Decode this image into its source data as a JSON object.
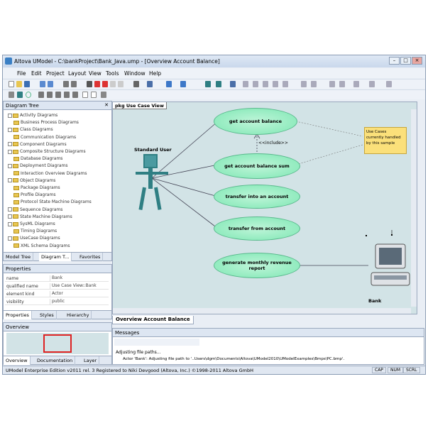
{
  "window": {
    "title": "Altova UModel - C:\\bankProject\\Bank_Java.ump - [Overview Account Balance]"
  },
  "menu": [
    "File",
    "Edit",
    "Project",
    "Layout",
    "View",
    "Tools",
    "Window",
    "Help"
  ],
  "diagram_tree": {
    "title": "Diagram Tree",
    "items": [
      {
        "label": "Activity Diagrams",
        "expand": true
      },
      {
        "label": "Business Process Diagrams",
        "expand": false
      },
      {
        "label": "Class Diagrams",
        "expand": true
      },
      {
        "label": "Communication Diagrams",
        "expand": false
      },
      {
        "label": "Component Diagrams",
        "expand": true
      },
      {
        "label": "Composite Structure Diagrams",
        "expand": true
      },
      {
        "label": "Database Diagrams",
        "expand": false
      },
      {
        "label": "Deployment Diagrams",
        "expand": true
      },
      {
        "label": "Interaction Overview Diagrams",
        "expand": false
      },
      {
        "label": "Object Diagrams",
        "expand": true
      },
      {
        "label": "Package Diagrams",
        "expand": false
      },
      {
        "label": "Profile Diagrams",
        "expand": false
      },
      {
        "label": "Protocol State Machine Diagrams",
        "expand": false
      },
      {
        "label": "Sequence Diagrams",
        "expand": true
      },
      {
        "label": "State Machine Diagrams",
        "expand": true
      },
      {
        "label": "SysML Diagrams",
        "expand": true
      },
      {
        "label": "Timing Diagrams",
        "expand": false
      },
      {
        "label": "UseCase Diagrams",
        "expand": true
      },
      {
        "label": "XML Schema Diagrams",
        "expand": false
      }
    ],
    "tabs": [
      "Model Tree",
      "Diagram T...",
      "Favorites"
    ]
  },
  "properties": {
    "title": "Properties",
    "rows": [
      {
        "key": "name",
        "value": "Bank"
      },
      {
        "key": "qualified name",
        "value": "Use Case View::Bank"
      },
      {
        "key": "element kind",
        "value": "Actor"
      },
      {
        "key": "visibility",
        "value": "public"
      }
    ],
    "tabs": [
      "Properties",
      "Styles",
      "Hierarchy"
    ]
  },
  "overview": {
    "title": "Overview",
    "tabs": [
      "Overview",
      "Documentation",
      "Layer"
    ]
  },
  "diagram": {
    "package_label": "pkg Use Case View",
    "tab_label": "Overview Account Balance",
    "actor_user": "Standard User",
    "actor_bank": "Bank",
    "use_cases": [
      "get account balance",
      "get account balance sum",
      "transfer into an account",
      "transfer from account",
      "generate monthly revenue report"
    ],
    "include_label": "<<include>>",
    "note": "Use Cases currently handled by this sample"
  },
  "messages": {
    "title": "Messages",
    "lines": [
      "Adjusting file paths...",
      "Actor 'Bank': Adjusting file path to '..Users\\dgm\\Documents\\Altova\\UModel2010\\UModelExamples\\Bmps\\PC.bmp'."
    ]
  },
  "status": {
    "text": "UModel Enterprise Edition v2011 rel. 3   Registered to Niki Devgood (Altova, Inc.)   ©1998-2011 Altova GmbH",
    "cap": "CAP",
    "num": "NUM",
    "scrl": "SCRL"
  },
  "colors": {
    "use_case_fill": "#7fe7b4",
    "note_fill": "#fbe07a",
    "canvas": "#d2e3e6",
    "actor": "#2f7f83"
  }
}
